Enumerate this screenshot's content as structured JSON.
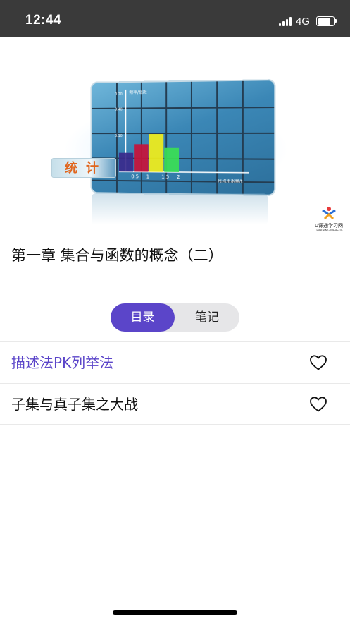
{
  "status_bar": {
    "time": "12:44",
    "network": "4G",
    "icons": [
      "signal-icon",
      "battery-icon"
    ]
  },
  "banner": {
    "overlay_label": "统计",
    "logo_text": "U课通学习网",
    "logo_subtext": "LEARNING WEBSITE",
    "chart_data": {
      "type": "bar",
      "categories": [
        "0.5",
        "1",
        "1.5",
        "2"
      ],
      "values": [
        0.15,
        0.22,
        0.3,
        0.19
      ],
      "ylabel": "频率/组距",
      "xlabel": "月均用水量/t",
      "yticks": [
        "0.20",
        "0.40",
        "0.10"
      ],
      "colors": [
        "#3a2a8c",
        "#c8123a",
        "#f2ee1a",
        "#3be055"
      ]
    }
  },
  "title": "第一章 集合与函数的概念（二）",
  "tabs": [
    {
      "label": "目录",
      "active": true
    },
    {
      "label": "笔记",
      "active": false
    }
  ],
  "lessons": [
    {
      "label": "描述法PK列举法",
      "active": true,
      "icon": "heart-outline-icon"
    },
    {
      "label": "子集与真子集之大战",
      "active": false,
      "icon": "heart-outline-icon"
    }
  ],
  "colors": {
    "accent": "#5b45c9",
    "status_bar_bg": "#3a3a3a"
  }
}
